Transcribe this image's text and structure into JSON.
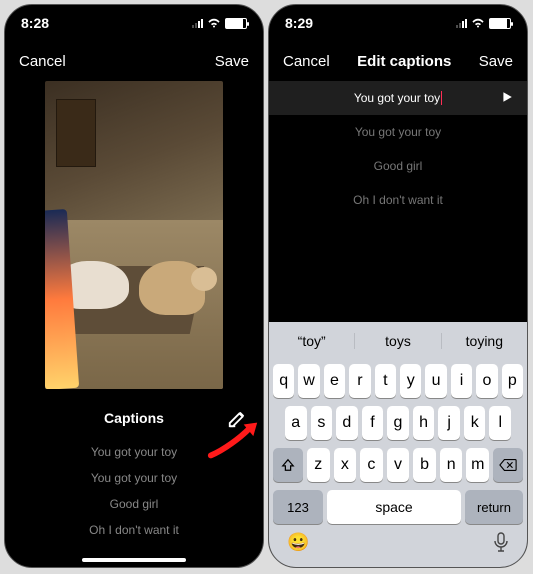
{
  "left": {
    "time": "8:28",
    "cancel": "Cancel",
    "save": "Save",
    "captions_heading": "Captions",
    "captions": [
      "You got your toy",
      "You got your toy",
      "Good girl",
      "Oh I don't want it"
    ]
  },
  "right": {
    "time": "8:29",
    "cancel": "Cancel",
    "title": "Edit captions",
    "save": "Save",
    "captions": [
      "You got your toy",
      "You got your toy",
      "Good girl",
      "Oh I don't want it"
    ],
    "suggestions": [
      "“toy”",
      "toys",
      "toying"
    ],
    "keys_r1": [
      "q",
      "w",
      "e",
      "r",
      "t",
      "y",
      "u",
      "i",
      "o",
      "p"
    ],
    "keys_r2": [
      "a",
      "s",
      "d",
      "f",
      "g",
      "h",
      "j",
      "k",
      "l"
    ],
    "keys_r3": [
      "z",
      "x",
      "c",
      "v",
      "b",
      "n",
      "m"
    ],
    "num_key": "123",
    "space_key": "space",
    "return_key": "return"
  }
}
